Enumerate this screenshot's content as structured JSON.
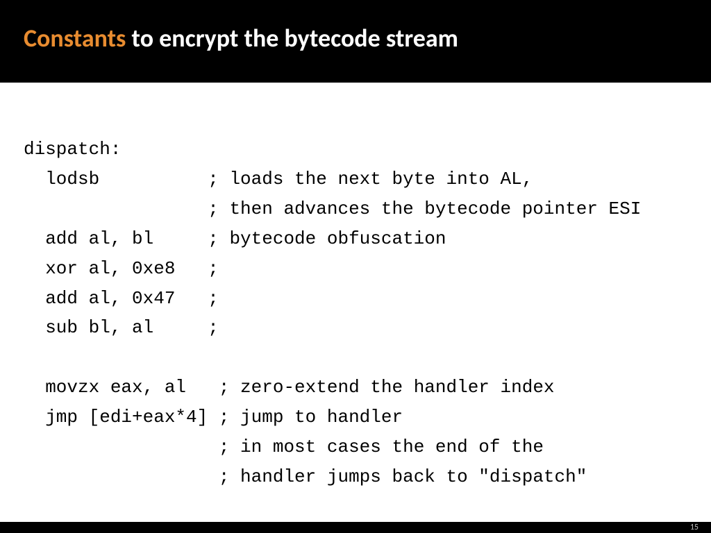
{
  "title": {
    "highlight": "Constants",
    "rest": " to encrypt the bytecode stream"
  },
  "code": {
    "label": "dispatch:",
    "l1_op": "lodsb",
    "l1_cmt": "; loads the next byte into AL,",
    "l2_cmt": "; then advances the bytecode pointer ESI",
    "l3_op": "add al, bl",
    "l3_cmt": "; bytecode obfuscation",
    "l4_op": "xor al, 0xe8",
    "l4_cmt": ";",
    "l5_op": "add al, 0x47",
    "l5_cmt": ";",
    "l6_op": "sub bl, al",
    "l6_cmt": ";",
    "l7_op": "movzx eax, al",
    "l7_cmt": "; zero-extend the handler index",
    "l8_op": "jmp [edi+eax*4]",
    "l8_cmt": "; jump to handler",
    "l9_cmt": "; in most cases the end of the",
    "l10_cmt": "; handler jumps back to \"dispatch\""
  },
  "footer": {
    "page": "15"
  }
}
